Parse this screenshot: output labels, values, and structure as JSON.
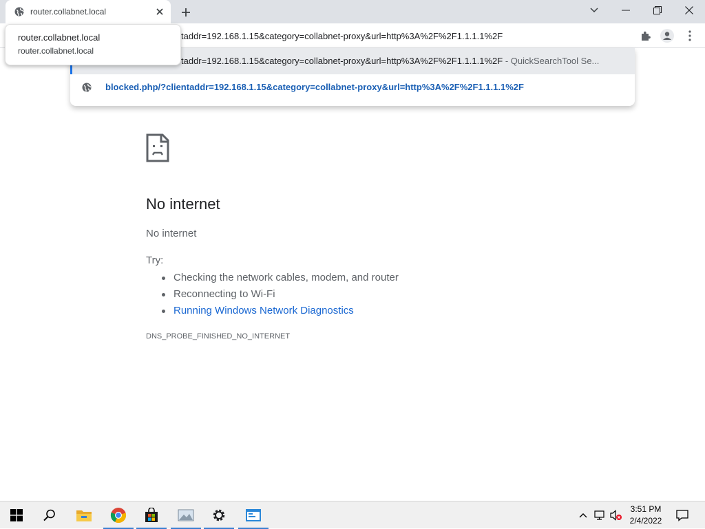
{
  "tab": {
    "title": "router.collabnet.local",
    "favicon": "globe-icon",
    "close": "close-icon"
  },
  "window_controls": {
    "menu": "chevron-down-icon",
    "minimize": "minimize-icon",
    "restore": "restore-icon",
    "close": "close-icon"
  },
  "toolbar": {
    "omnibox_text": "tadd​r=192.168.1.15&category=collabnet-proxy&url=http%3A%2F%2F1.1.1.1%2F",
    "extensions": "puzzle-icon",
    "profile": "profile-icon",
    "menu": "more-vert-icon"
  },
  "tooltip": {
    "title": "router.collabnet.local",
    "url": "router.collabnet.local"
  },
  "suggestions": [
    {
      "text": "tadd​r=192.168.1.15&category=collabnet-proxy&url=http%3A%2F%2F1.1.1.1%2F",
      "separator": " - ",
      "source": "QuickSearchTool Se..."
    },
    {
      "text": "blocked.php/?clientaddr=192.168.1.15&category=collabnet-proxy&url=http%3A%2F%2F1.1.1.1%2F"
    }
  ],
  "error_page": {
    "title": "No internet",
    "subtitle": "No internet",
    "try_label": "Try:",
    "try_items": [
      "Checking the network cables, modem, and router",
      "Reconnecting to Wi-Fi",
      "Running Windows Network Diagnostics"
    ],
    "error_code": "DNS_PROBE_FINISHED_NO_INTERNET"
  },
  "taskbar": {
    "apps": [
      "windows-start-icon",
      "search-icon",
      "file-explorer-icon",
      "chrome-icon",
      "store-icon",
      "image-viewer-icon",
      "settings-icon",
      "app-icon"
    ],
    "clock": {
      "time": "3:51 PM",
      "date": "2/4/2022"
    }
  },
  "colors": {
    "link": "#1967d2",
    "accent": "#1a73e8",
    "tabstrip": "#dee1e6",
    "taskbar": "#f0f0f0"
  }
}
